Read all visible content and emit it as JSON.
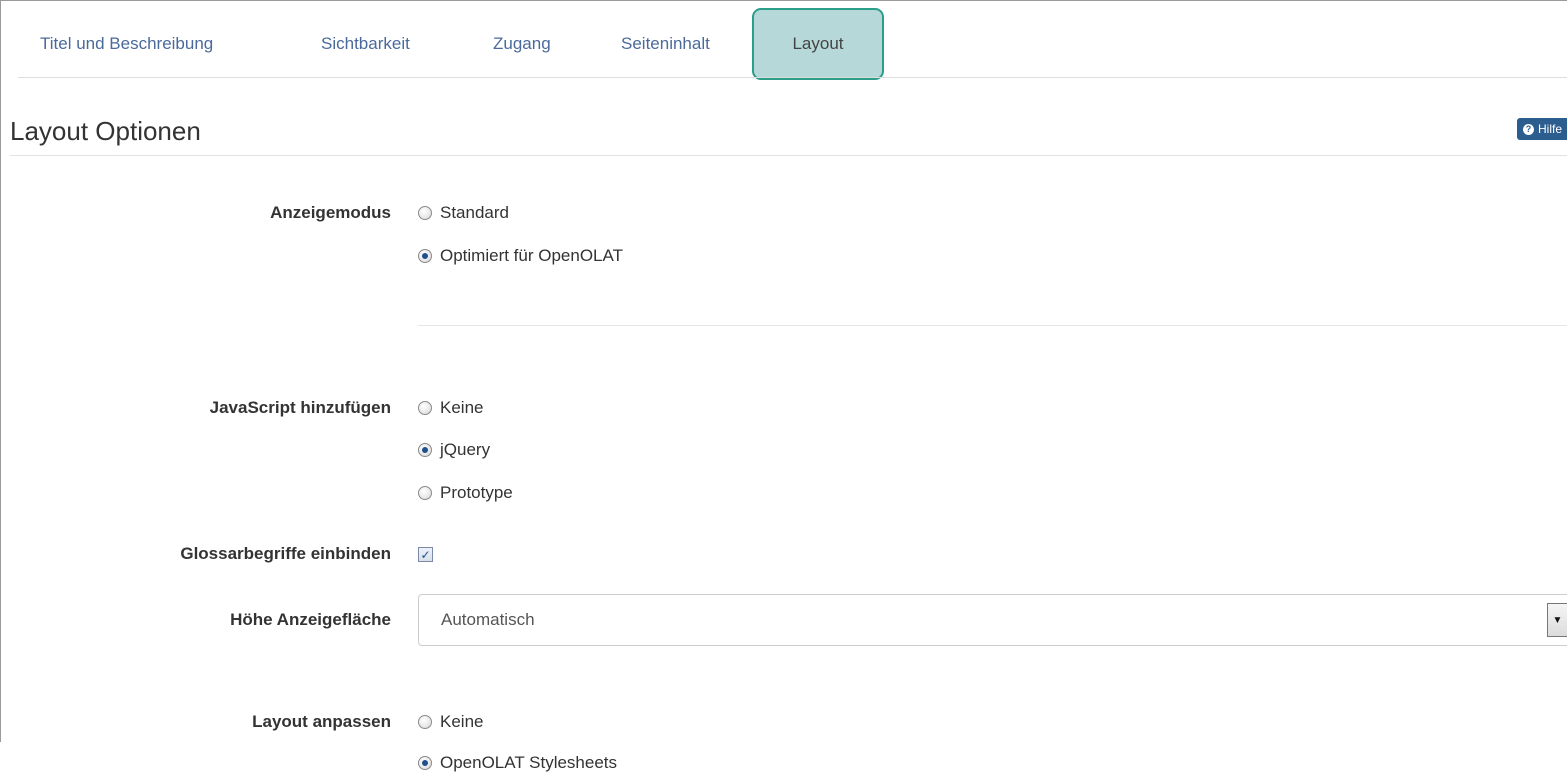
{
  "tabs": [
    {
      "label": "Titel und Beschreibung"
    },
    {
      "label": "Sichtbarkeit"
    },
    {
      "label": "Zugang"
    },
    {
      "label": "Seiteninhalt"
    },
    {
      "label": "Layout",
      "active": true
    }
  ],
  "header": {
    "title": "Layout Optionen",
    "help_label": "Hilfe",
    "help_icon": "question-circle-icon"
  },
  "form": {
    "display_mode": {
      "label": "Anzeigemodus",
      "options": [
        "Standard",
        "Optimiert für OpenOLAT"
      ],
      "selected": "Optimiert für OpenOLAT"
    },
    "javascript": {
      "label": "JavaScript hinzufügen",
      "options": [
        "Keine",
        "jQuery",
        "Prototype"
      ],
      "selected": "jQuery"
    },
    "glossary": {
      "label": "Glossarbegriffe einbinden",
      "checked": true
    },
    "height": {
      "label": "Höhe Anzeigefläche",
      "value": "Automatisch"
    },
    "layout_customize": {
      "label": "Layout anpassen",
      "options": [
        "Keine",
        "OpenOLAT Stylesheets"
      ],
      "selected": "OpenOLAT Stylesheets"
    }
  },
  "colors": {
    "tab_text": "#4a6a9c",
    "active_tab_bg": "#b6d8d8",
    "active_tab_border": "#2b9e8a",
    "help_bg": "#2c5d8f"
  }
}
